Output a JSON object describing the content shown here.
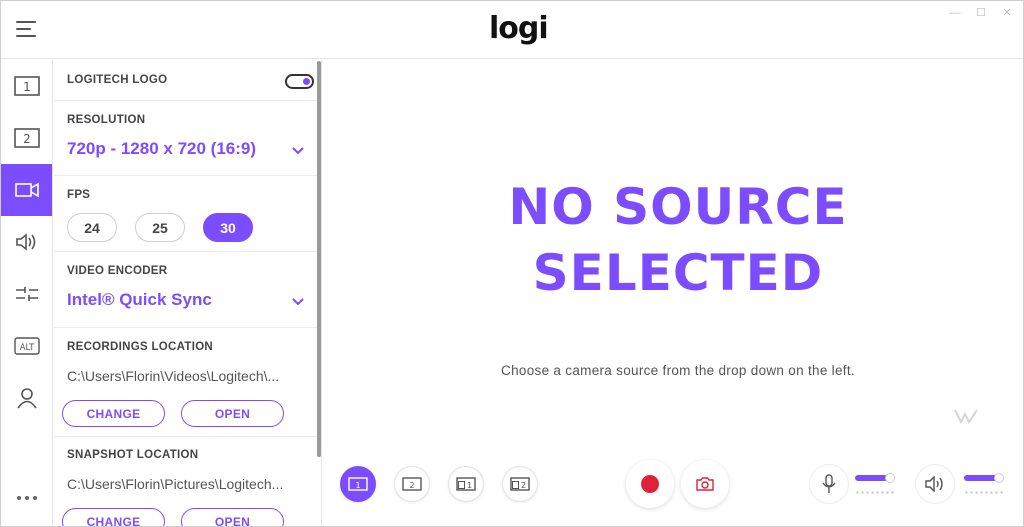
{
  "app": {
    "brand": "logi"
  },
  "window_controls": [
    "—",
    "☐",
    "✕"
  ],
  "rail": {
    "items": [
      {
        "id": "scene-1",
        "text": "1",
        "icon": "scene-1-icon",
        "active": false
      },
      {
        "id": "scene-2",
        "text": "2",
        "icon": "scene-2-icon",
        "active": false
      },
      {
        "id": "camera",
        "icon": "video-camera-icon",
        "active": true
      },
      {
        "id": "audio",
        "icon": "speaker-icon",
        "active": false
      },
      {
        "id": "transitions",
        "icon": "transition-icon",
        "active": false
      },
      {
        "id": "alt",
        "text": "ALT",
        "icon": "alt-icon",
        "active": false
      },
      {
        "id": "account",
        "icon": "user-icon",
        "active": false
      }
    ]
  },
  "panel": {
    "logo": {
      "label": "LOGITECH LOGO",
      "enabled": true
    },
    "resolution": {
      "label": "RESOLUTION",
      "value": "720p - 1280 x 720 (16:9)"
    },
    "fps": {
      "label": "FPS",
      "options": [
        "24",
        "25",
        "30"
      ],
      "selected": "30"
    },
    "encoder": {
      "label": "VIDEO ENCODER",
      "value": "Intel® Quick Sync"
    },
    "recordings": {
      "label": "RECORDINGS LOCATION",
      "path": "C:\\Users\\Florin\\Videos\\Logitech\\...",
      "change": "CHANGE",
      "open": "OPEN"
    },
    "snapshot": {
      "label": "SNAPSHOT LOCATION",
      "path": "C:\\Users\\Florin\\Pictures\\Logitech...",
      "change": "CHANGE",
      "open": "OPEN"
    }
  },
  "main": {
    "title_line1": "NO SOURCE",
    "title_line2": "SELECTED",
    "hint": "Choose a camera source from the drop down on the left."
  },
  "toolbar": {
    "layouts": [
      {
        "id": "layout-1",
        "text": "1",
        "active": true
      },
      {
        "id": "layout-2",
        "text": "2",
        "active": false
      },
      {
        "id": "layout-pip-1",
        "text": "1",
        "active": false
      },
      {
        "id": "layout-pip-2",
        "text": "2",
        "active": false
      }
    ],
    "mic_level": 0.85,
    "volume_level": 0.85
  },
  "colors": {
    "accent": "#7c4dff",
    "record": "#e0213a"
  }
}
